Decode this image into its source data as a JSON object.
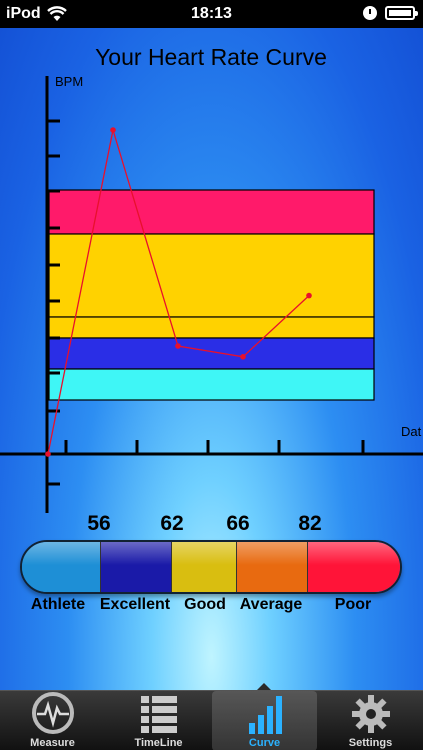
{
  "status_bar": {
    "carrier": "iPod",
    "time": "18:13"
  },
  "chart_data": {
    "type": "line",
    "title": "Your Heart Rate Curve",
    "ylabel": "BPM",
    "xlabel": "Dat",
    "series": [
      {
        "values": [
          0,
          9,
          3,
          2.7,
          4.4
        ]
      }
    ],
    "bands": [
      "#ff1a6a",
      "#ffd200",
      "#ffd200",
      "#2a2ee6",
      "#3ff6f6"
    ],
    "line_color": "#e8102c"
  },
  "legend": {
    "thresholds": [
      "56",
      "62",
      "66",
      "82"
    ],
    "categories": [
      {
        "label": "Athlete",
        "color": "#1e8fd6"
      },
      {
        "label": "Excellent",
        "color": "#1a1aa8"
      },
      {
        "label": "Good",
        "color": "#d9be10"
      },
      {
        "label": "Average",
        "color": "#e86a10"
      },
      {
        "label": "Poor",
        "color": "#ff1438"
      }
    ]
  },
  "tabs": [
    {
      "label": "Measure",
      "icon": "heartbeat-icon"
    },
    {
      "label": "TimeLine",
      "icon": "list-icon"
    },
    {
      "label": "Curve",
      "icon": "bar-chart-icon",
      "active": true
    },
    {
      "label": "Settings",
      "icon": "gear-icon"
    }
  ]
}
